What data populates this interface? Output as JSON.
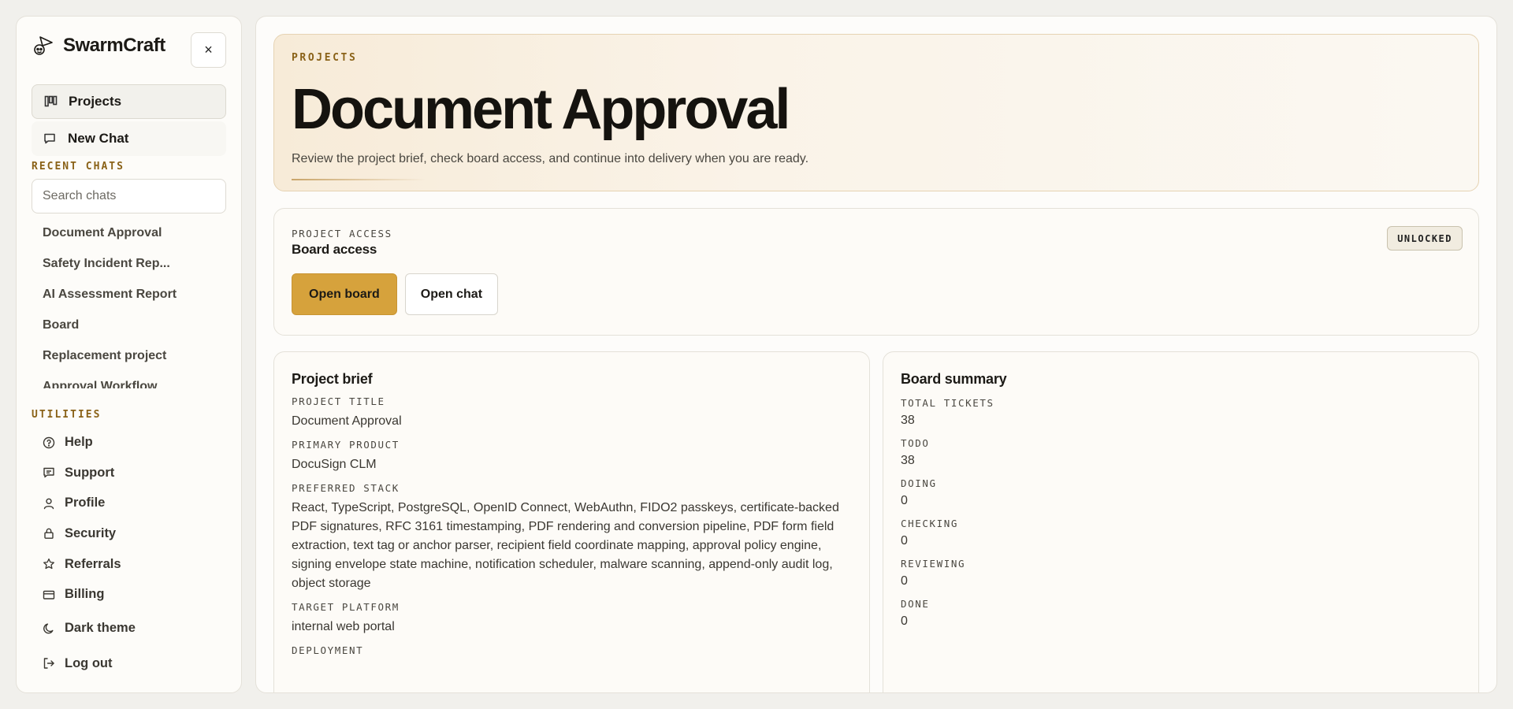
{
  "app": {
    "name": "SwarmCraft"
  },
  "sidebar": {
    "close_label": "×",
    "nav": [
      {
        "label": "Projects",
        "icon": "kanban-icon"
      },
      {
        "label": "New Chat",
        "icon": "chat-icon"
      }
    ],
    "recent_label": "RECENT CHATS",
    "search_placeholder": "Search chats",
    "chats": [
      "Document Approval",
      "Safety Incident Rep...",
      "AI Assessment Report",
      "Board",
      "Replacement project",
      "Approval Workflow"
    ],
    "utilities_label": "UTILITIES",
    "utilities": [
      {
        "label": "Help",
        "icon": "help-circle-icon"
      },
      {
        "label": "Support",
        "icon": "message-square-icon"
      },
      {
        "label": "Profile",
        "icon": "user-icon"
      },
      {
        "label": "Security",
        "icon": "lock-icon"
      },
      {
        "label": "Referrals",
        "icon": "star-icon"
      },
      {
        "label": "Billing",
        "icon": "credit-card-icon"
      }
    ],
    "theme_label": "Dark theme",
    "logout_label": "Log out"
  },
  "hero": {
    "eyebrow": "PROJECTS",
    "title": "Document Approval",
    "subtitle": "Review the project brief, check board access, and continue into delivery when you are ready."
  },
  "access": {
    "eyebrow": "PROJECT ACCESS",
    "title": "Board access",
    "badge": "UNLOCKED",
    "open_board": "Open board",
    "open_chat": "Open chat"
  },
  "brief": {
    "title": "Project brief",
    "fields": [
      {
        "label": "PROJECT TITLE",
        "value": "Document Approval"
      },
      {
        "label": "PRIMARY PRODUCT",
        "value": "DocuSign CLM"
      },
      {
        "label": "PREFERRED STACK",
        "value": "React, TypeScript, PostgreSQL, OpenID Connect, WebAuthn, FIDO2 passkeys, certificate-backed PDF signatures, RFC 3161 timestamping, PDF rendering and conversion pipeline, PDF form field extraction, text tag or anchor parser, recipient field coordinate mapping, approval policy engine, signing envelope state machine, notification scheduler, malware scanning, append-only audit log, object storage"
      },
      {
        "label": "TARGET PLATFORM",
        "value": "internal web portal"
      },
      {
        "label": "DEPLOYMENT",
        "value": ""
      }
    ]
  },
  "summary": {
    "title": "Board summary",
    "stats": [
      {
        "label": "TOTAL TICKETS",
        "value": "38"
      },
      {
        "label": "TODO",
        "value": "38"
      },
      {
        "label": "DOING",
        "value": "0"
      },
      {
        "label": "CHECKING",
        "value": "0"
      },
      {
        "label": "REVIEWING",
        "value": "0"
      },
      {
        "label": "DONE",
        "value": "0"
      }
    ]
  },
  "colors": {
    "accent": "#d6a23c",
    "eyebrow": "#8a6218",
    "background": "#f1f0ec"
  }
}
